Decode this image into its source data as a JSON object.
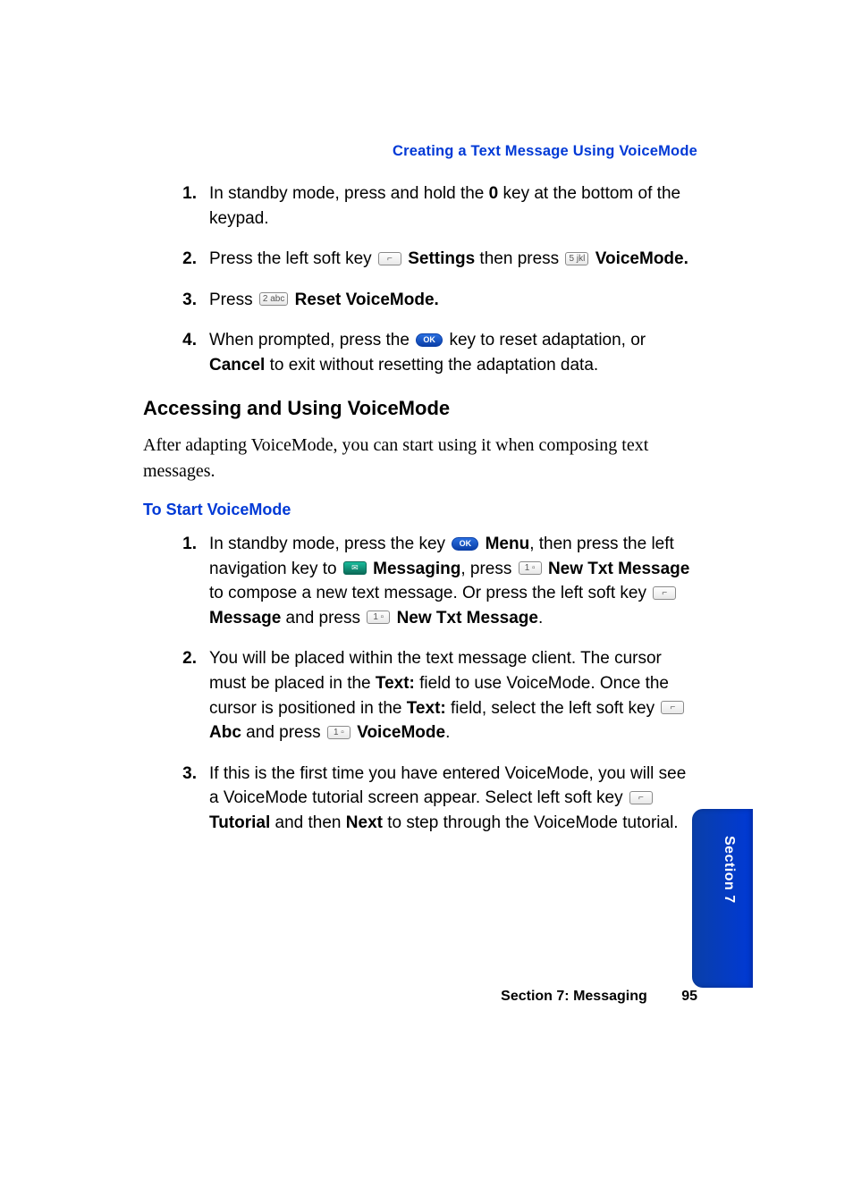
{
  "header": "Creating a Text Message Using VoiceMode",
  "listA": {
    "1": {
      "pre": "In standby mode, press and hold the ",
      "bold1": "0",
      "post": " key at the bottom of the keypad."
    },
    "2": {
      "pre": "Press the left soft key ",
      "bold1": "Settings",
      "mid": " then press ",
      "bold2": "VoiceMode."
    },
    "3": {
      "pre": "Press ",
      "bold1": "Reset VoiceMode."
    },
    "4": {
      "pre": "When prompted, press the ",
      "mid": " key to reset adaptation, or ",
      "bold1": "Cancel",
      "post": " to exit without resetting the adaptation data."
    }
  },
  "heading": "Accessing and Using VoiceMode",
  "intro": "After adapting VoiceMode, you can start using it when composing text messages.",
  "subhead": "To Start VoiceMode",
  "listB": {
    "1": {
      "a": "In standby mode, press the key ",
      "menu": "Menu",
      "b": ", then press the left navigation key to ",
      "messaging": "Messaging",
      "c": ", press ",
      "newtxt": "New Txt Message",
      "d": " to compose a new text message. Or press the left soft key ",
      "message": "Message",
      "e": " and press ",
      "newtxt2": "New Txt Message",
      "f": "."
    },
    "2": {
      "a": "You will be placed within the text message client. The cursor must be placed in the ",
      "text1": "Text:",
      "b": " field to use VoiceMode. Once the cursor is positioned in the ",
      "text2": "Text:",
      "c": " field, select the left soft key ",
      "abc": "Abc",
      "d": " and press ",
      "vm": "VoiceMode",
      "e": "."
    },
    "3": {
      "a": "If this is the first time you have entered VoiceMode, you will see a VoiceMode tutorial screen appear. Select left soft key ",
      "tut": "Tutorial",
      "b": " and then ",
      "next": "Next",
      "c": " to step through the VoiceMode tutorial."
    }
  },
  "footer": {
    "section": "Section 7: Messaging",
    "page": "95"
  },
  "tab": "Section 7",
  "icons": {
    "soft": "⌐",
    "five": "5 jkl",
    "two": "2 abc",
    "ok": "OK",
    "one": "1 ▫",
    "msg": "✉"
  }
}
